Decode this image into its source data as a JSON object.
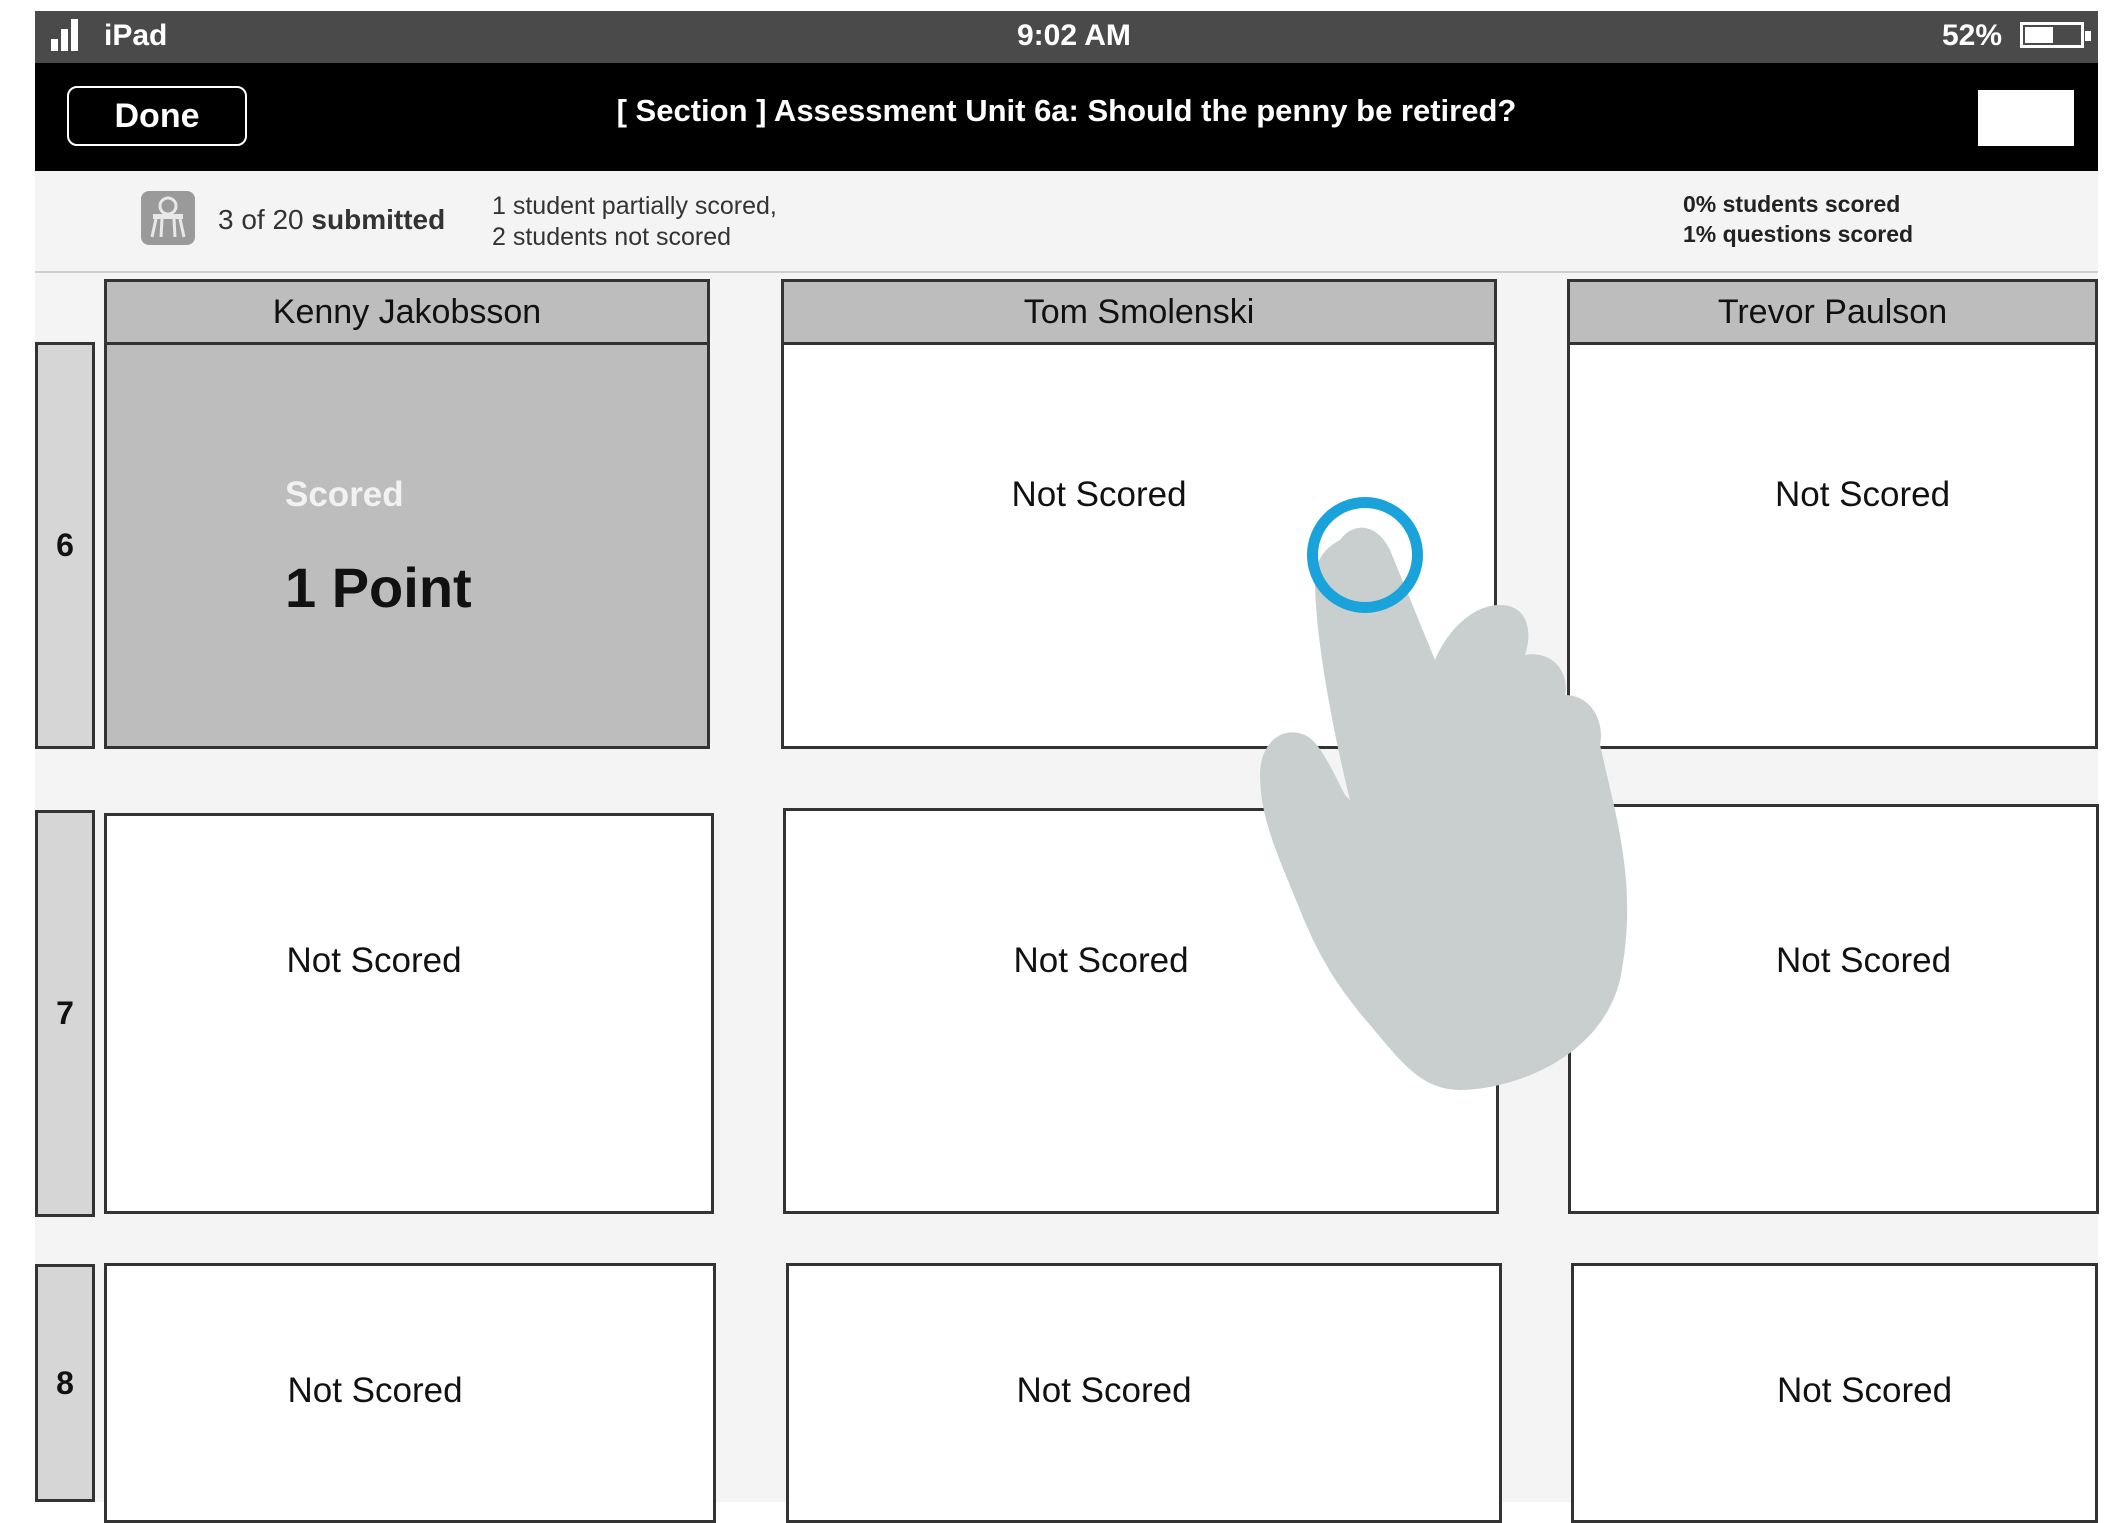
{
  "status_bar": {
    "carrier": "iPad",
    "time": "9:02 AM",
    "battery_text": "52%",
    "battery_level": 0.52
  },
  "title_bar": {
    "done_label": "Done",
    "title": "[ Section ] Assessment Unit 6a: Should the penny be retired?"
  },
  "info_bar": {
    "submitted_count": "3 of 20",
    "submitted_word": "submitted",
    "partial_line": "1 student partially scored,",
    "not_scored_line": "2 students not scored",
    "students_scored": "0% students scored",
    "questions_scored": "1% questions scored"
  },
  "grid": {
    "students": [
      "Kenny Jakobsson",
      "Tom Smolenski",
      "Trevor Paulson"
    ],
    "rows": [
      {
        "question": "6",
        "cells": [
          {
            "status": "Scored",
            "points": "1 Point"
          },
          {
            "status": "Not Scored"
          },
          {
            "status": "Not Scored"
          }
        ]
      },
      {
        "question": "7",
        "cells": [
          {
            "status": "Not Scored"
          },
          {
            "status": "Not Scored"
          },
          {
            "status": "Not Scored"
          }
        ]
      },
      {
        "question": "8",
        "cells": [
          {
            "status": "Not Scored"
          },
          {
            "status": "Not Scored"
          },
          {
            "status": "Not Scored"
          }
        ]
      }
    ]
  },
  "colors": {
    "touch_ring": "#1aa3da",
    "hand": "#c9cfcf",
    "scored_cell": "#bdbdbd"
  },
  "icons": [
    "signal-icon",
    "battery-icon",
    "student-desk-icon",
    "touch-ring-icon",
    "hand-pointer-icon"
  ]
}
